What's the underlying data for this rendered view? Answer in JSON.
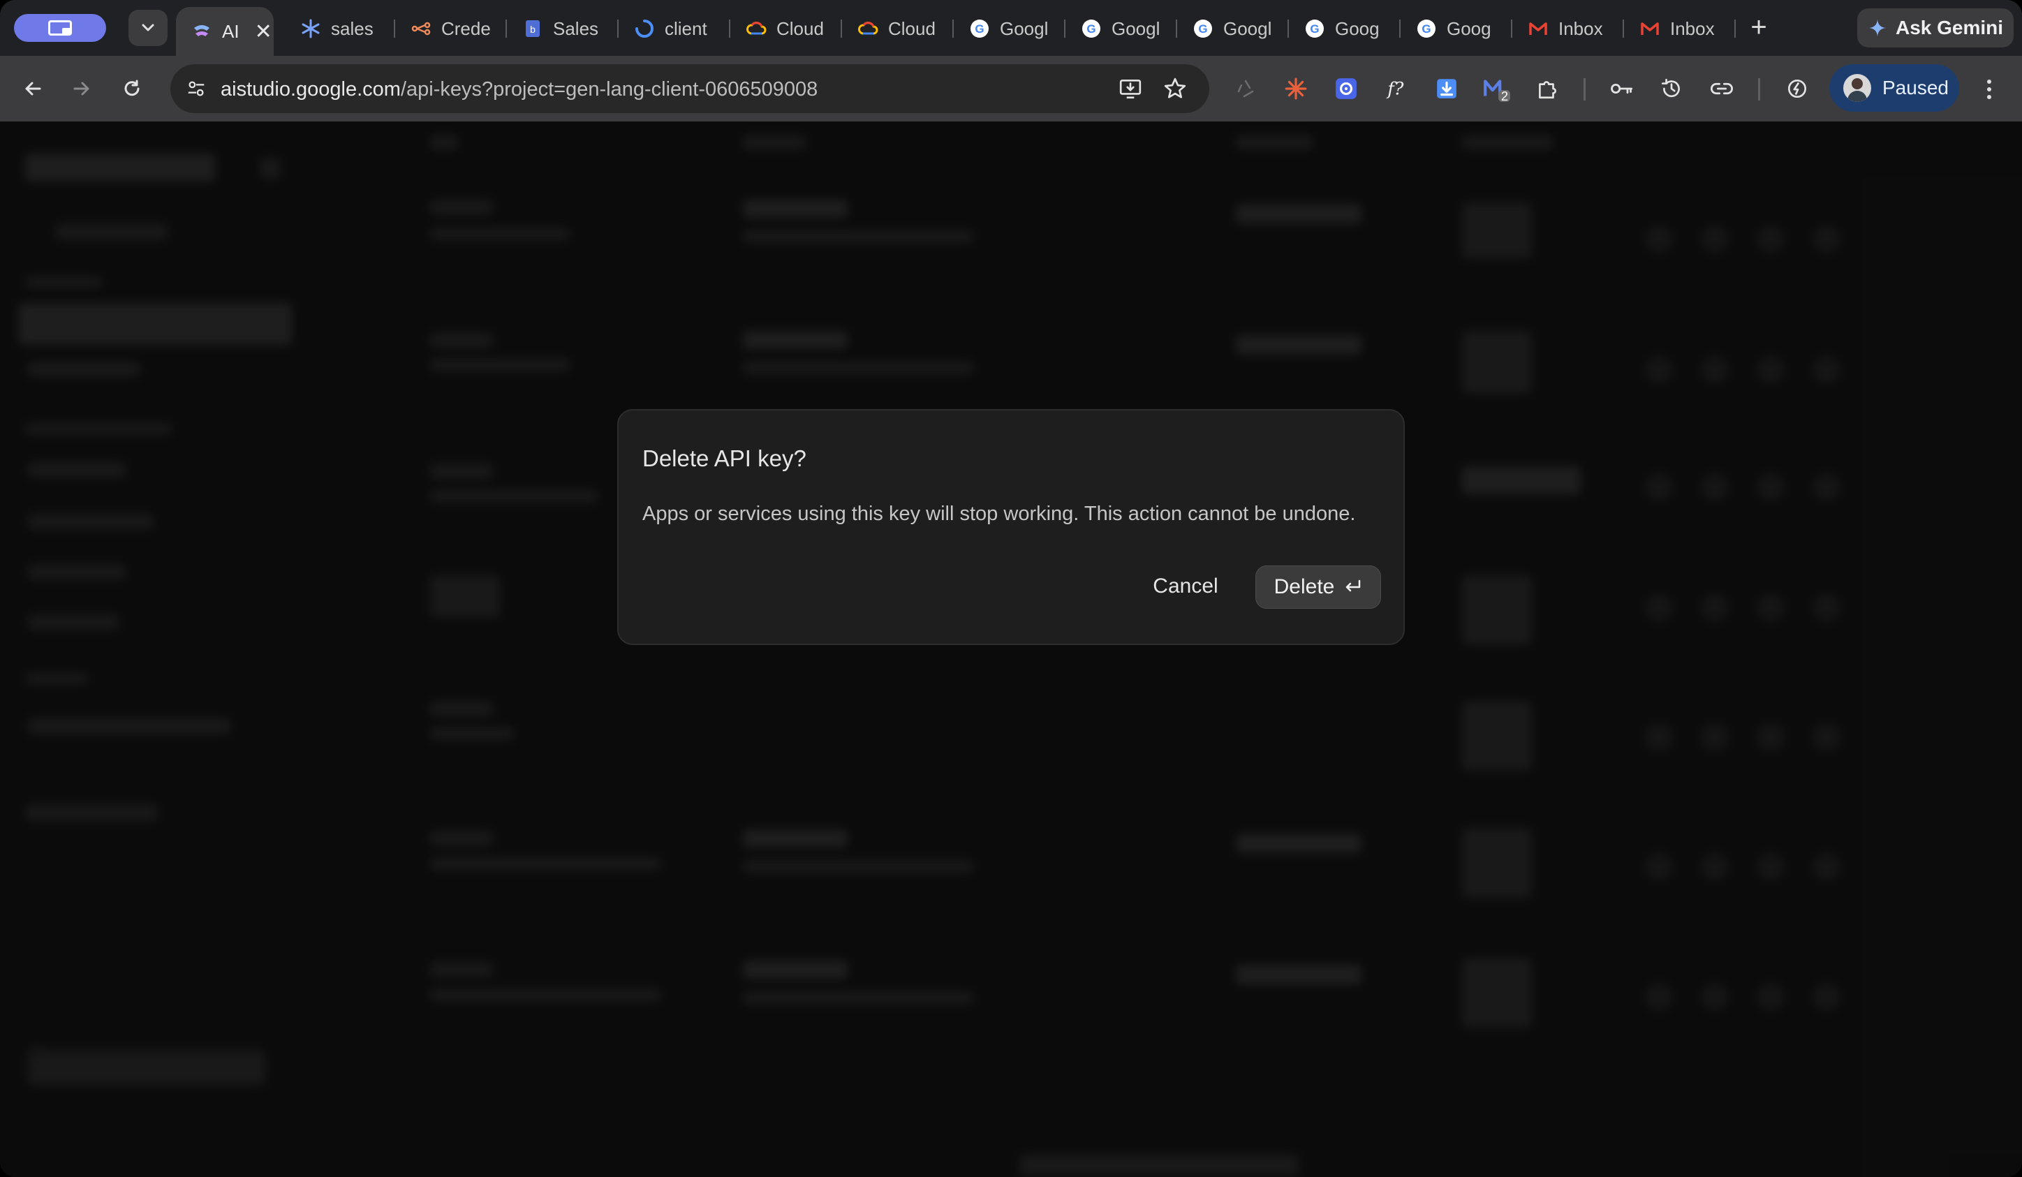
{
  "browser": {
    "tabs": [
      {
        "label": "AI",
        "favicon": "ai-studio-icon",
        "active": true
      },
      {
        "label": "sales",
        "favicon": "asterisk-icon"
      },
      {
        "label": "Crede",
        "favicon": "connector-icon"
      },
      {
        "label": "Sales",
        "favicon": "document-icon"
      },
      {
        "label": "client",
        "favicon": "loader-icon"
      },
      {
        "label": "Cloud",
        "favicon": "google-cloud-icon"
      },
      {
        "label": "Cloud",
        "favicon": "google-cloud-icon"
      },
      {
        "label": "Googl",
        "favicon": "google-icon"
      },
      {
        "label": "Googl",
        "favicon": "google-icon"
      },
      {
        "label": "Googl",
        "favicon": "google-icon"
      },
      {
        "label": "Goog",
        "favicon": "google-icon"
      },
      {
        "label": "Goog",
        "favicon": "google-icon"
      },
      {
        "label": "Inbox",
        "favicon": "gmail-icon"
      },
      {
        "label": "Inbox",
        "favicon": "gmail-icon"
      }
    ],
    "ask_gemini_label": "Ask Gemini",
    "url_host": "aistudio.google.com",
    "url_path": "/api-keys?project=gen-lang-client-0606509008",
    "profile_label": "Paused",
    "extension_badge": "2",
    "colors": {
      "profile_pill": "#6f79e8",
      "paused_pill": "#1d3d6e"
    }
  },
  "dialog": {
    "title": "Delete API key?",
    "body": "Apps or services using this key will stop working. This action cannot be undone.",
    "cancel_label": "Cancel",
    "delete_label": "Delete",
    "delete_icon": "enter-key-icon"
  }
}
